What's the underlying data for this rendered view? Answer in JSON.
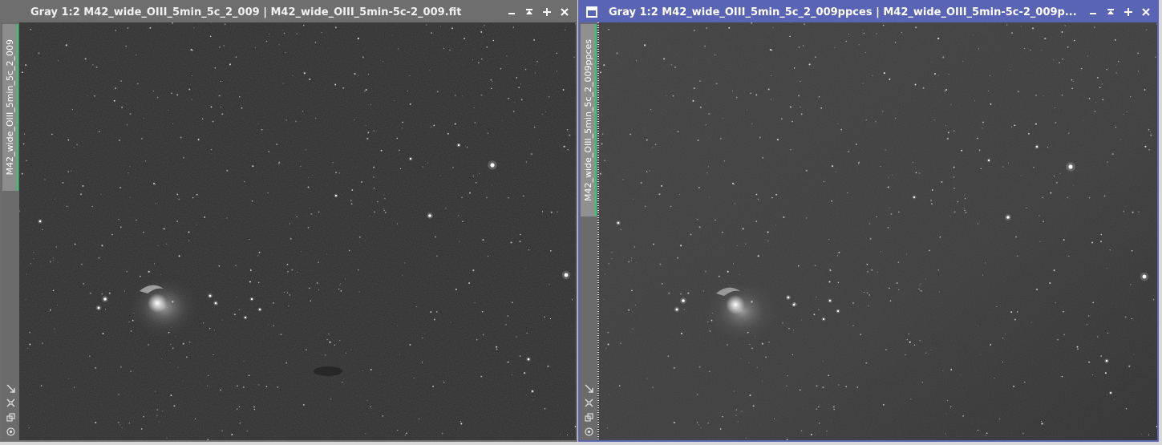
{
  "windows": [
    {
      "title": "Gray 1:2 M42_wide_OIII_5min_5c_2_009 | M42_wide_OIII_5min-5c-2_009.fit",
      "tab_label": "M42_wide_OIII_5min_5c_2_009",
      "active": false
    },
    {
      "title": "Gray 1:2 M42_wide_OIII_5min_5c_2_009ppces | M42_wide_OIII_5min-5c-2_009p...",
      "tab_label": "M42_wide_OIII_5min_5c_2_009ppces",
      "active": true
    }
  ],
  "controls": {
    "minimize_icon": "minimize-icon",
    "shade_icon": "shade-icon",
    "maximize_icon": "maximize-icon",
    "close_icon": "close-icon"
  },
  "side_tools": [
    "zoom-fit-icon",
    "fit-view-icon",
    "clone-icon",
    "target-icon"
  ],
  "colors": {
    "inactive_frame": "#6e6e6e",
    "active_frame": "#5a64b4",
    "tab_indicator": "#2ecc71"
  }
}
